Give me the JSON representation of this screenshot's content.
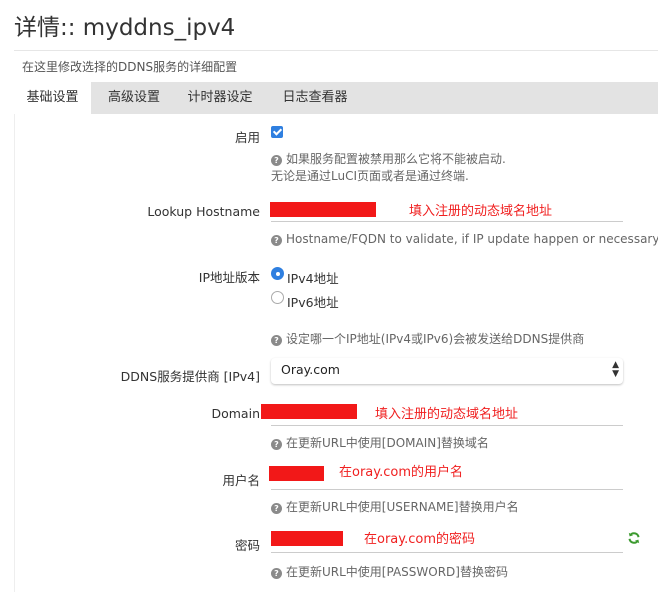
{
  "header": {
    "title": "详情:: myddns_ipv4",
    "description": "在这里修改选择的DDNS服务的详细配置"
  },
  "tabs": [
    {
      "label": "基础设置",
      "active": true
    },
    {
      "label": "高级设置",
      "active": false
    },
    {
      "label": "计时器设定",
      "active": false
    },
    {
      "label": "日志查看器",
      "active": false
    }
  ],
  "form": {
    "enable": {
      "label": "启用",
      "checked": true,
      "help_line1": "如果服务配置被禁用那么它将不能被启动.",
      "help_line2": "无论是通过LuCI页面或者是通过终端."
    },
    "lookup_hostname": {
      "label": "Lookup Hostname",
      "annotation": "填入注册的动态域名地址",
      "help": "Hostname/FQDN to validate, if IP update happen or necessary"
    },
    "ip_version": {
      "label": "IP地址版本",
      "options": [
        "IPv4地址",
        "IPv6地址"
      ],
      "selected": "IPv4地址",
      "help": "设定哪一个IP地址(IPv4或IPv6)会被发送给DDNS提供商"
    },
    "provider": {
      "label": "DDNS服务提供商 [IPv4]",
      "value": "Oray.com",
      "arrow": "▲▼"
    },
    "domain": {
      "label": "Domain",
      "annotation": "填入注册的动态域名地址",
      "help": "在更新URL中使用[DOMAIN]替换域名"
    },
    "username": {
      "label": "用户名",
      "annotation": "在oray.com的用户名",
      "help": "在更新URL中使用[USERNAME]替换用户名"
    },
    "password": {
      "label": "密码",
      "annotation": "在oray.com的密码",
      "help": "在更新URL中使用[PASSWORD]替换密码",
      "reveal_icon": "refresh-icon"
    }
  },
  "colors": {
    "accent": "#2f7fe0",
    "redaction": "#f21818",
    "annotation": "#f02020",
    "tab_bar": "#e3e3e3",
    "help_icon": "#8a8a8a"
  },
  "icons": {
    "help": "question-circle-icon",
    "select": "sort-arrows-icon",
    "password_toggle": "refresh-icon"
  }
}
